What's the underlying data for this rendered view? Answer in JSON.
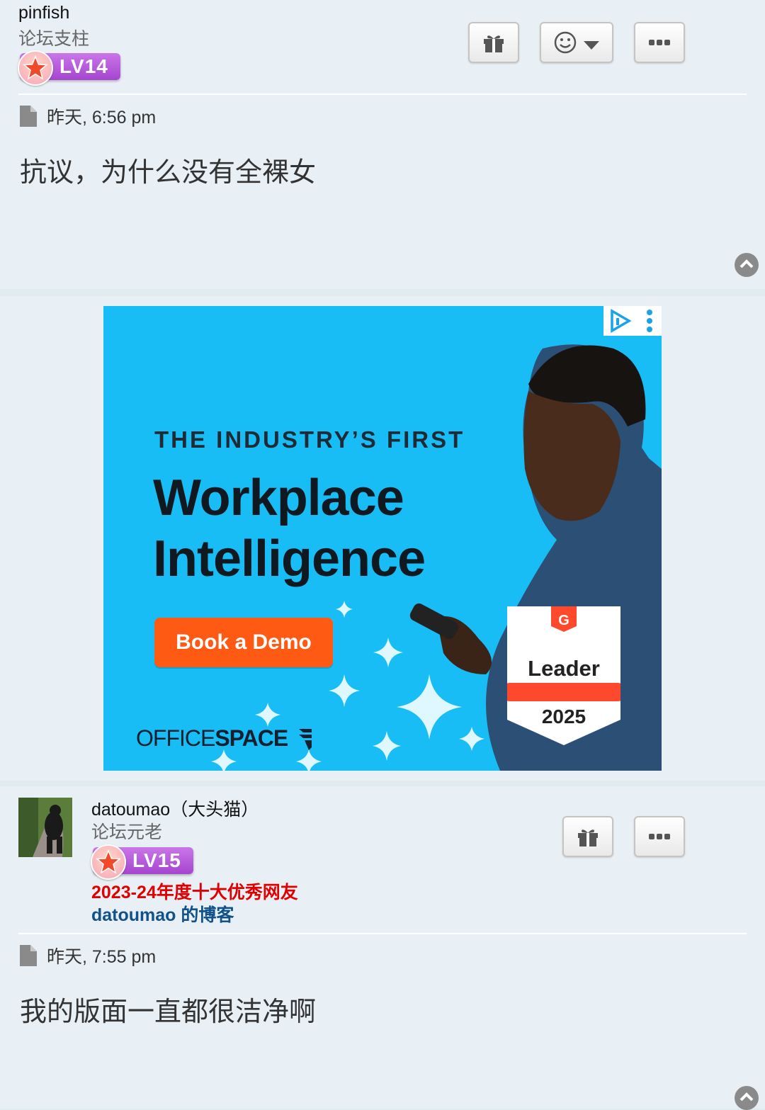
{
  "posts": [
    {
      "username": "pinfish",
      "rank": "论坛支柱",
      "level": "LV14",
      "time": "昨天, 6:56 pm",
      "content": "抗议，为什么没有全裸女"
    },
    {
      "username": "datoumao（大头猫）",
      "rank": "论坛元老",
      "level": "LV15",
      "honor": "2023-24年度十大优秀网友",
      "blog": "datoumao 的博客",
      "time": "昨天, 7:55 pm",
      "content": "我的版面一直都很洁净啊"
    }
  ],
  "ad": {
    "kicker": "THE INDUSTRY’S FIRST",
    "headline_line1": "Workplace",
    "headline_line2": "Intelligence",
    "cta": "Book a Demo",
    "brand_light": "OFFICE",
    "brand_bold": "SPACE",
    "badge_title": "Leader",
    "badge_year": "2025",
    "background": "#19bdf5",
    "cta_color": "#ff5a14"
  },
  "colors": {
    "page_bg": "#e1ebf2",
    "post_bg": "#e9f0f5",
    "honor": "#e00000",
    "blog_link": "#105289"
  }
}
